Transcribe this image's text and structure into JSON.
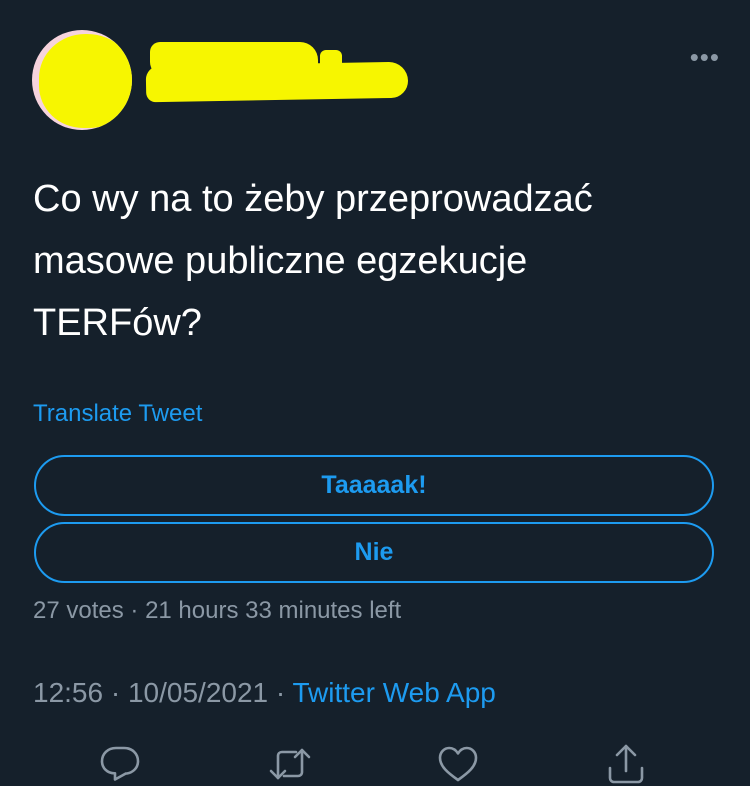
{
  "header": {
    "more_label": "•••"
  },
  "tweet": {
    "text": "Co wy na to żeby przeprowadzać\nmasowe publiczne egzekucje\nTERFów?",
    "translate_label": "Translate Tweet"
  },
  "poll": {
    "options": [
      "Taaaaak!",
      "Nie"
    ],
    "votes_text": "27 votes",
    "separator": " · ",
    "time_left": "21 hours 33 minutes left"
  },
  "meta": {
    "time": "12:56",
    "date": "10/05/2021",
    "separator": " · ",
    "app": "Twitter Web App"
  },
  "actions": [
    "reply-icon",
    "retweet-icon",
    "like-icon",
    "share-icon"
  ],
  "colors": {
    "background": "#15202b",
    "accent": "#1d9bf0",
    "muted": "#8b98a5",
    "redaction": "#f7f600"
  }
}
